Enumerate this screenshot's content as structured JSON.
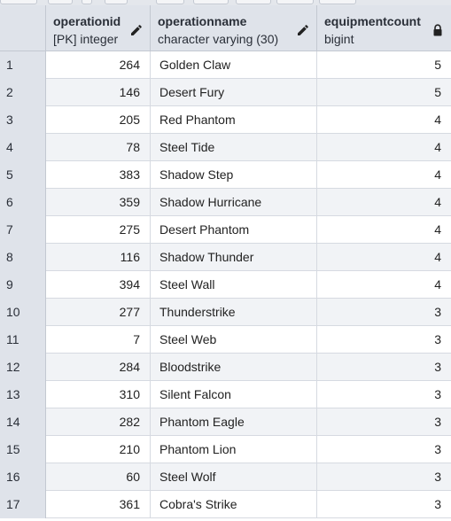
{
  "columns": [
    {
      "name": "operationid",
      "type": "[PK] integer",
      "icon": "edit-pencil-icon"
    },
    {
      "name": "operationname",
      "type": "character varying (30)",
      "icon": "edit-pencil-icon"
    },
    {
      "name": "equipmentcount",
      "type": "bigint",
      "icon": "lock-icon"
    }
  ],
  "rows": [
    {
      "num": "1",
      "operationid": "264",
      "operationname": "Golden Claw",
      "equipmentcount": "5"
    },
    {
      "num": "2",
      "operationid": "146",
      "operationname": "Desert Fury",
      "equipmentcount": "5"
    },
    {
      "num": "3",
      "operationid": "205",
      "operationname": "Red Phantom",
      "equipmentcount": "4"
    },
    {
      "num": "4",
      "operationid": "78",
      "operationname": "Steel Tide",
      "equipmentcount": "4"
    },
    {
      "num": "5",
      "operationid": "383",
      "operationname": "Shadow Step",
      "equipmentcount": "4"
    },
    {
      "num": "6",
      "operationid": "359",
      "operationname": "Shadow Hurricane",
      "equipmentcount": "4"
    },
    {
      "num": "7",
      "operationid": "275",
      "operationname": "Desert Phantom",
      "equipmentcount": "4"
    },
    {
      "num": "8",
      "operationid": "116",
      "operationname": "Shadow Thunder",
      "equipmentcount": "4"
    },
    {
      "num": "9",
      "operationid": "394",
      "operationname": "Steel Wall",
      "equipmentcount": "4"
    },
    {
      "num": "10",
      "operationid": "277",
      "operationname": "Thunderstrike",
      "equipmentcount": "3"
    },
    {
      "num": "11",
      "operationid": "7",
      "operationname": "Steel Web",
      "equipmentcount": "3"
    },
    {
      "num": "12",
      "operationid": "284",
      "operationname": "Bloodstrike",
      "equipmentcount": "3"
    },
    {
      "num": "13",
      "operationid": "310",
      "operationname": "Silent Falcon",
      "equipmentcount": "3"
    },
    {
      "num": "14",
      "operationid": "282",
      "operationname": "Phantom Eagle",
      "equipmentcount": "3"
    },
    {
      "num": "15",
      "operationid": "210",
      "operationname": "Phantom Lion",
      "equipmentcount": "3"
    },
    {
      "num": "16",
      "operationid": "60",
      "operationname": "Steel Wolf",
      "equipmentcount": "3"
    },
    {
      "num": "17",
      "operationid": "361",
      "operationname": "Cobra's Strike",
      "equipmentcount": "3"
    }
  ]
}
